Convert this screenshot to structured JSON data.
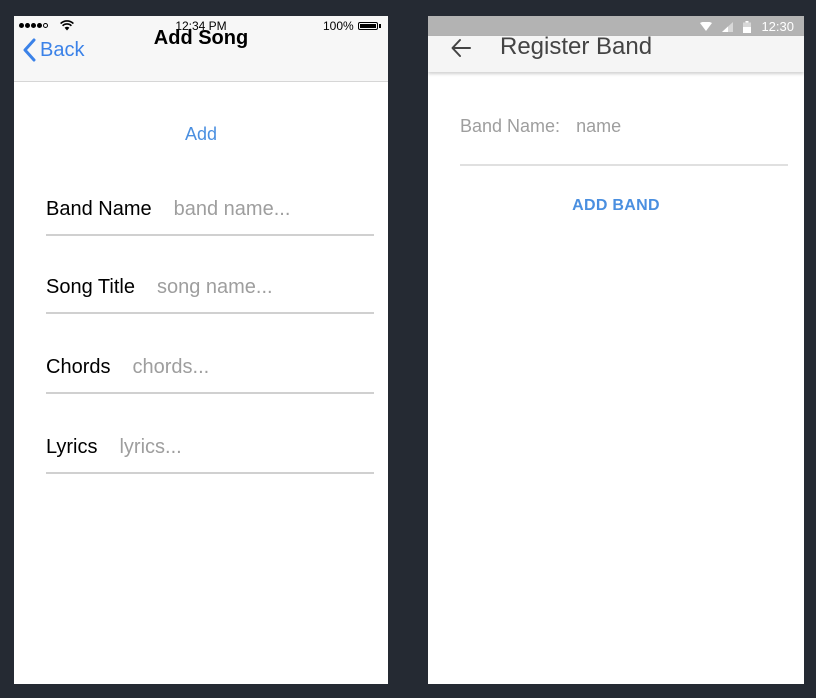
{
  "ios": {
    "status": {
      "time": "12:34 PM",
      "battery": "100%"
    },
    "nav": {
      "back_label": "Back",
      "title": "Add Song"
    },
    "add_label": "Add",
    "fields": [
      {
        "label": "Band Name",
        "placeholder": "band name..."
      },
      {
        "label": "Song Title",
        "placeholder": "song name..."
      },
      {
        "label": "Chords",
        "placeholder": "chords..."
      },
      {
        "label": "Lyrics",
        "placeholder": "lyrics..."
      }
    ]
  },
  "android": {
    "status": {
      "time": "12:30"
    },
    "toolbar": {
      "title": "Register Band"
    },
    "field": {
      "label": "Band Name:",
      "placeholder": "name"
    },
    "add_button": "ADD BAND"
  },
  "colors": {
    "background": "#252a33",
    "accent": "#4a8fe0",
    "ios_back": "#3b82e8",
    "android_status_bar": "#b3b3b3"
  }
}
